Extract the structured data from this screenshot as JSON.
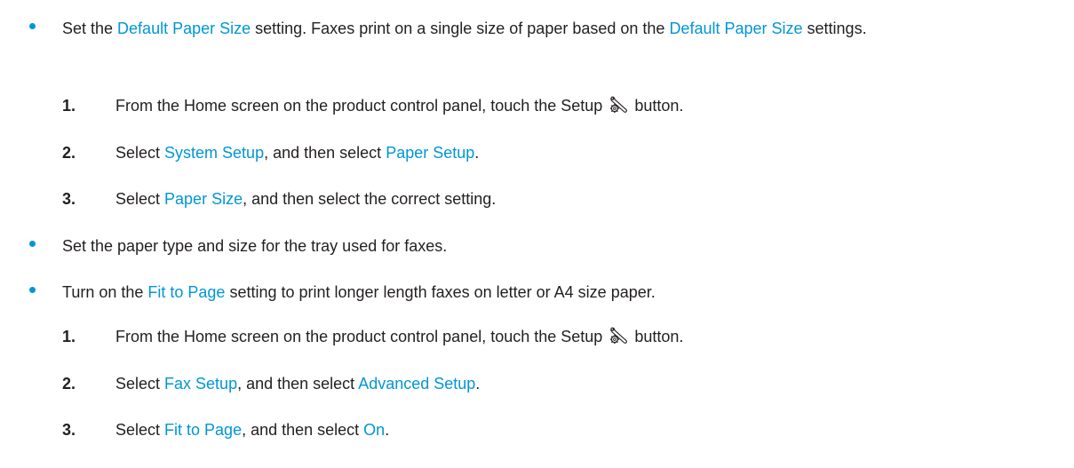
{
  "colors": {
    "accent": "#0096d6",
    "text": "#231f20"
  },
  "bullets": [
    {
      "parts": [
        {
          "t": "Set the "
        },
        {
          "t": "Default Paper Size",
          "link": true
        },
        {
          "t": " setting. Faxes print on a single size of paper based on the "
        },
        {
          "t": "Default Paper Size",
          "link": true
        },
        {
          "t": " settings."
        }
      ]
    },
    {
      "parts": [
        {
          "t": "Set the paper type and size for the tray used for faxes."
        }
      ]
    },
    {
      "parts": [
        {
          "t": "Turn on the "
        },
        {
          "t": "Fit to Page",
          "link": true
        },
        {
          "t": " setting to print longer length faxes on letter or A4 size paper."
        }
      ]
    }
  ],
  "steps_a": [
    {
      "num": "1.",
      "parts": [
        {
          "t": "From the Home screen on the product control panel, touch the Setup "
        },
        {
          "icon": "setup-wrench-gear-icon"
        },
        {
          "t": " button."
        }
      ]
    },
    {
      "num": "2.",
      "parts": [
        {
          "t": "Select "
        },
        {
          "t": "System Setup",
          "link": true
        },
        {
          "t": ", and then select "
        },
        {
          "t": "Paper Setup",
          "link": true
        },
        {
          "t": "."
        }
      ]
    },
    {
      "num": "3.",
      "parts": [
        {
          "t": "Select "
        },
        {
          "t": "Paper Size",
          "link": true
        },
        {
          "t": ", and then select the correct setting."
        }
      ]
    }
  ],
  "steps_b": [
    {
      "num": "1.",
      "parts": [
        {
          "t": "From the Home screen on the product control panel, touch the Setup "
        },
        {
          "icon": "setup-wrench-gear-icon"
        },
        {
          "t": " button."
        }
      ]
    },
    {
      "num": "2.",
      "parts": [
        {
          "t": "Select "
        },
        {
          "t": "Fax Setup",
          "link": true
        },
        {
          "t": ", and then select "
        },
        {
          "t": "Advanced Setup",
          "link": true
        },
        {
          "t": "."
        }
      ]
    },
    {
      "num": "3.",
      "parts": [
        {
          "t": "Select "
        },
        {
          "t": "Fit to Page",
          "link": true
        },
        {
          "t": ", and then select "
        },
        {
          "t": "On",
          "link": true
        },
        {
          "t": "."
        }
      ]
    }
  ]
}
